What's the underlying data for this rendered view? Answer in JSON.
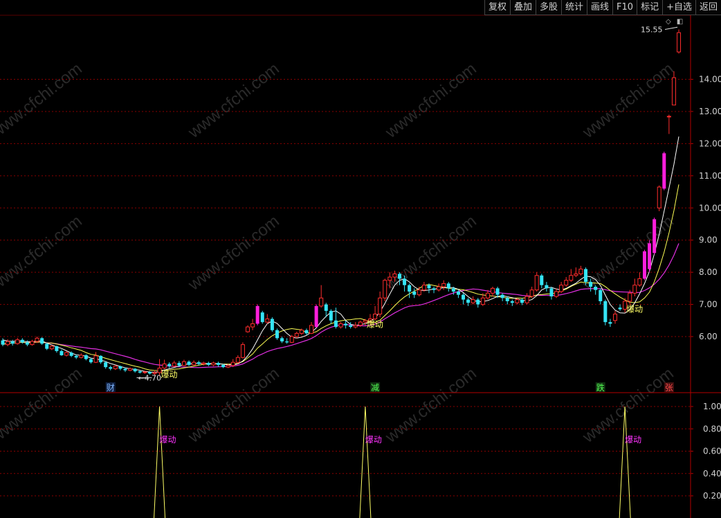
{
  "toolbar": {
    "items": [
      "复权",
      "叠加",
      "多股",
      "统计",
      "画线",
      "F10",
      "标记",
      "+自选",
      "返回"
    ]
  },
  "icons": [
    "diamond-icon",
    "toggle-icon"
  ],
  "watermark": "www.cfchi.com",
  "colors": {
    "up": "#ff2d2d",
    "down": "#35e4f5",
    "limit_up": "#ff1fdc",
    "ma_short": "#ffffff",
    "ma_mid": "#ffff55",
    "ma_long": "#e22fe2",
    "grid": "#8b0000",
    "axis": "#b40000",
    "signal_label": "#ffff66",
    "indicator_label": "#ff33ff"
  },
  "chart_data": [
    {
      "type": "candlestick",
      "title": "",
      "ylim": [
        5.0,
        16.0
      ],
      "y_ticks": [
        "14.00",
        "13.00",
        "12.00",
        "11.00",
        "10.00",
        "9.00",
        "8.00",
        "7.00",
        "6.00"
      ],
      "grid": true,
      "candles": [
        [
          5.88,
          5.75,
          5.95,
          5.7
        ],
        [
          5.75,
          5.85,
          5.92,
          5.7
        ],
        [
          5.85,
          5.78,
          5.9,
          5.72
        ],
        [
          5.78,
          5.9,
          5.96,
          5.75
        ],
        [
          5.9,
          5.82,
          5.95,
          5.78
        ],
        [
          5.82,
          5.75,
          5.88,
          5.7
        ],
        [
          5.75,
          5.85,
          5.9,
          5.72
        ],
        [
          5.85,
          5.95,
          6.0,
          5.8
        ],
        [
          5.95,
          5.78,
          5.98,
          5.74
        ],
        [
          5.78,
          5.62,
          5.8,
          5.58
        ],
        [
          5.62,
          5.7,
          5.74,
          5.58
        ],
        [
          5.7,
          5.55,
          5.72,
          5.5
        ],
        [
          5.55,
          5.42,
          5.6,
          5.4
        ],
        [
          5.42,
          5.5,
          5.55,
          5.38
        ],
        [
          5.5,
          5.4,
          5.54,
          5.36
        ],
        [
          5.4,
          5.35,
          5.45,
          5.3
        ],
        [
          5.35,
          5.42,
          5.48,
          5.32
        ],
        [
          5.42,
          5.3,
          5.45,
          5.26
        ],
        [
          5.3,
          5.2,
          5.34,
          5.16
        ],
        [
          5.2,
          5.4,
          5.52,
          5.18
        ],
        [
          5.4,
          5.2,
          5.42,
          5.15
        ],
        [
          5.2,
          5.05,
          5.24,
          5.0
        ],
        [
          5.05,
          5.0,
          5.1,
          4.95
        ],
        [
          5.0,
          5.08,
          5.12,
          4.96
        ],
        [
          5.08,
          5.0,
          5.1,
          4.95
        ],
        [
          5.0,
          4.95,
          5.04,
          4.9
        ],
        [
          4.95,
          5.0,
          5.04,
          4.92
        ],
        [
          5.0,
          4.92,
          5.02,
          4.88
        ],
        [
          4.92,
          4.88,
          4.95,
          4.85
        ],
        [
          4.88,
          4.9,
          4.94,
          4.84
        ],
        [
          4.9,
          4.85,
          4.93,
          4.82
        ],
        [
          4.85,
          4.88,
          4.95,
          4.8
        ],
        [
          4.88,
          5.02,
          5.3,
          4.78
        ],
        [
          5.02,
          5.15,
          5.28,
          4.98
        ],
        [
          5.15,
          5.08,
          5.2,
          5.02
        ],
        [
          5.08,
          5.18,
          5.25,
          5.05
        ],
        [
          5.18,
          5.1,
          5.24,
          5.06
        ],
        [
          5.1,
          5.22,
          5.28,
          5.08
        ],
        [
          5.22,
          5.12,
          5.26,
          5.08
        ],
        [
          5.12,
          5.2,
          5.26,
          5.1
        ],
        [
          5.2,
          5.15,
          5.25,
          5.1
        ],
        [
          5.15,
          5.18,
          5.22,
          5.1
        ],
        [
          5.18,
          5.12,
          5.22,
          5.08
        ],
        [
          5.12,
          5.18,
          5.22,
          5.08
        ],
        [
          5.18,
          5.12,
          5.22,
          5.06
        ],
        [
          5.12,
          5.05,
          5.15,
          5.02
        ],
        [
          5.05,
          5.1,
          5.15,
          5.02
        ],
        [
          5.1,
          5.2,
          5.3,
          5.05
        ],
        [
          5.2,
          5.35,
          5.42,
          5.15
        ],
        [
          5.35,
          5.75,
          5.82,
          5.32
        ],
        [
          6.15,
          6.3,
          6.35,
          6.12
        ],
        [
          6.3,
          6.4,
          6.55,
          6.2
        ],
        [
          6.4,
          6.95,
          7.0,
          6.35
        ],
        [
          6.75,
          6.45,
          6.8,
          6.4
        ],
        [
          6.45,
          6.55,
          6.7,
          6.4
        ],
        [
          6.55,
          6.2,
          6.6,
          6.15
        ],
        [
          6.2,
          5.95,
          6.25,
          5.9
        ],
        [
          5.95,
          5.85,
          6.0,
          5.8
        ],
        [
          5.85,
          5.82,
          5.95,
          5.78
        ],
        [
          5.82,
          6.0,
          6.05,
          5.8
        ],
        [
          6.0,
          6.1,
          6.15,
          5.95
        ],
        [
          6.1,
          6.2,
          6.25,
          6.05
        ],
        [
          6.2,
          6.1,
          6.25,
          6.05
        ],
        [
          6.1,
          6.35,
          6.45,
          6.08
        ],
        [
          6.3,
          6.95,
          7.0,
          6.28
        ],
        [
          6.95,
          7.2,
          7.6,
          6.9
        ],
        [
          7.0,
          6.8,
          7.05,
          6.6
        ],
        [
          6.8,
          6.5,
          6.85,
          6.4
        ],
        [
          6.5,
          6.3,
          6.9,
          6.25
        ],
        [
          6.3,
          6.4,
          6.45,
          6.25
        ],
        [
          6.4,
          6.35,
          6.5,
          6.25
        ],
        [
          6.35,
          6.3,
          6.45,
          6.25
        ],
        [
          6.3,
          6.35,
          6.45,
          6.25
        ],
        [
          6.35,
          6.45,
          6.5,
          6.3
        ],
        [
          6.45,
          6.5,
          6.55,
          6.35
        ],
        [
          6.5,
          6.55,
          6.7,
          6.4
        ],
        [
          6.55,
          6.7,
          6.95,
          6.5
        ],
        [
          6.7,
          7.2,
          7.4,
          6.6
        ],
        [
          7.2,
          7.75,
          7.8,
          7.1
        ],
        [
          7.75,
          7.85,
          8.0,
          7.5
        ],
        [
          7.85,
          7.95,
          8.05,
          7.7
        ],
        [
          7.95,
          7.8,
          8.0,
          7.6
        ],
        [
          7.8,
          7.6,
          7.9,
          7.4
        ],
        [
          7.6,
          7.4,
          7.65,
          7.2
        ],
        [
          7.4,
          7.3,
          7.5,
          7.2
        ],
        [
          7.3,
          7.45,
          7.55,
          7.25
        ],
        [
          7.45,
          7.6,
          7.7,
          7.4
        ],
        [
          7.6,
          7.5,
          7.65,
          7.35
        ],
        [
          7.5,
          7.45,
          7.55,
          7.35
        ],
        [
          7.45,
          7.55,
          7.65,
          7.4
        ],
        [
          7.55,
          7.65,
          7.75,
          7.45
        ],
        [
          7.65,
          7.5,
          7.7,
          7.4
        ],
        [
          7.5,
          7.4,
          7.55,
          7.3
        ],
        [
          7.4,
          7.3,
          7.45,
          7.2
        ],
        [
          7.3,
          7.15,
          7.35,
          7.0
        ],
        [
          7.15,
          7.05,
          7.2,
          6.95
        ],
        [
          7.05,
          7.15,
          7.25,
          7.0
        ],
        [
          7.15,
          7.0,
          7.2,
          6.9
        ],
        [
          7.0,
          7.2,
          7.35,
          6.95
        ],
        [
          7.2,
          7.35,
          7.45,
          7.15
        ],
        [
          7.35,
          7.5,
          7.55,
          7.25
        ],
        [
          7.5,
          7.3,
          7.55,
          7.2
        ],
        [
          7.3,
          7.2,
          7.35,
          7.1
        ],
        [
          7.2,
          7.1,
          7.25,
          7.0
        ],
        [
          7.1,
          7.05,
          7.15,
          6.95
        ],
        [
          7.05,
          7.15,
          7.2,
          7.0
        ],
        [
          7.15,
          7.05,
          7.2,
          6.98
        ],
        [
          7.05,
          7.25,
          7.35,
          7.0
        ],
        [
          7.25,
          7.45,
          7.55,
          7.2
        ],
        [
          7.45,
          7.9,
          8.0,
          7.4
        ],
        [
          7.9,
          7.6,
          7.95,
          7.5
        ],
        [
          7.6,
          7.5,
          7.7,
          7.4
        ],
        [
          7.5,
          7.25,
          7.55,
          7.15
        ],
        [
          7.25,
          7.4,
          7.5,
          7.2
        ],
        [
          7.4,
          7.6,
          7.7,
          7.35
        ],
        [
          7.6,
          7.75,
          7.85,
          7.55
        ],
        [
          7.75,
          7.9,
          8.1,
          7.7
        ],
        [
          7.9,
          7.95,
          8.15,
          7.85
        ],
        [
          7.95,
          8.1,
          8.2,
          7.9
        ],
        [
          8.1,
          7.7,
          8.15,
          7.6
        ],
        [
          7.7,
          7.55,
          7.8,
          7.4
        ],
        [
          7.55,
          7.45,
          7.6,
          7.3
        ],
        [
          7.45,
          7.1,
          7.5,
          7.0
        ],
        [
          7.1,
          6.45,
          7.15,
          6.35
        ],
        [
          6.45,
          6.4,
          6.55,
          6.3
        ],
        [
          6.5,
          6.7,
          6.8,
          6.4
        ],
        [
          6.9,
          6.85,
          7.0,
          6.8
        ],
        [
          6.85,
          7.1,
          7.2,
          6.75
        ],
        [
          7.1,
          7.35,
          7.45,
          7.0
        ],
        [
          7.35,
          7.6,
          7.8,
          7.25
        ],
        [
          7.6,
          7.8,
          8.0,
          7.55
        ],
        [
          7.8,
          8.65,
          8.7,
          7.75
        ],
        [
          8.1,
          8.9,
          9.0,
          8.0
        ],
        [
          8.6,
          9.65,
          9.7,
          8.55
        ],
        [
          10.0,
          10.65,
          10.7,
          9.9
        ],
        [
          10.6,
          11.7,
          11.75,
          10.55
        ],
        [
          12.85,
          12.85,
          12.9,
          12.3
        ],
        [
          13.2,
          14.05,
          14.25,
          13.2
        ],
        [
          14.85,
          15.45,
          15.55,
          14.8
        ]
      ],
      "ma_short": [
        5.9,
        5.86,
        5.85,
        5.87,
        5.86,
        5.84,
        5.84,
        5.87,
        5.86,
        5.8,
        5.74,
        5.68,
        5.63,
        5.56,
        5.49,
        5.43,
        5.42,
        5.39,
        5.33,
        5.31,
        5.27,
        5.22,
        5.16,
        5.12,
        5.07,
        5.03,
        5.0,
        4.98,
        4.95,
        4.92,
        4.9,
        4.89,
        4.91,
        4.96,
        5.0,
        5.04,
        5.08,
        5.13,
        5.15,
        5.16,
        5.17,
        5.16,
        5.16,
        5.16,
        5.16,
        5.14,
        5.12,
        5.12,
        5.15,
        5.24,
        5.4,
        5.62,
        5.9,
        6.18,
        6.4,
        6.48,
        6.41,
        6.25,
        6.1,
        5.98,
        5.95,
        5.98,
        6.04,
        6.13,
        6.27,
        6.47,
        6.63,
        6.76,
        6.8,
        6.7,
        6.5,
        6.38,
        6.35,
        6.37,
        6.4,
        6.47,
        6.58,
        6.77,
        7.03,
        7.32,
        7.6,
        7.75,
        7.8,
        7.7,
        7.55,
        7.45,
        7.43,
        7.45,
        7.48,
        7.49,
        7.52,
        7.53,
        7.52,
        7.47,
        7.37,
        7.24,
        7.13,
        7.08,
        7.09,
        7.12,
        7.18,
        7.25,
        7.27,
        7.24,
        7.21,
        7.17,
        7.13,
        7.11,
        7.15,
        7.27,
        7.45,
        7.52,
        7.53,
        7.48,
        7.45,
        7.5,
        7.58,
        7.66,
        7.78,
        7.88,
        7.86,
        7.77,
        7.59,
        7.29,
        7.0,
        6.82,
        6.74,
        6.73,
        6.84,
        7.05,
        7.33,
        7.65,
        8.03,
        8.57,
        9.18,
        9.9,
        10.62,
        11.36,
        12.22
      ]
    },
    {
      "type": "line",
      "title": "",
      "ylim": [
        0,
        1.05
      ],
      "y_ticks": [
        "1.00",
        "0.80",
        "0.60",
        "0.40",
        "0.20"
      ],
      "grid": true,
      "series": [
        {
          "values": [
            [
              32,
              1.0
            ],
            [
              74,
              1.0
            ],
            [
              127,
              1.0
            ]
          ]
        }
      ]
    }
  ],
  "annotations": {
    "high_price": "15.55",
    "low_price": "4.70",
    "signal": "爆动",
    "markers": [
      "财",
      "减",
      "跌",
      "张"
    ]
  }
}
